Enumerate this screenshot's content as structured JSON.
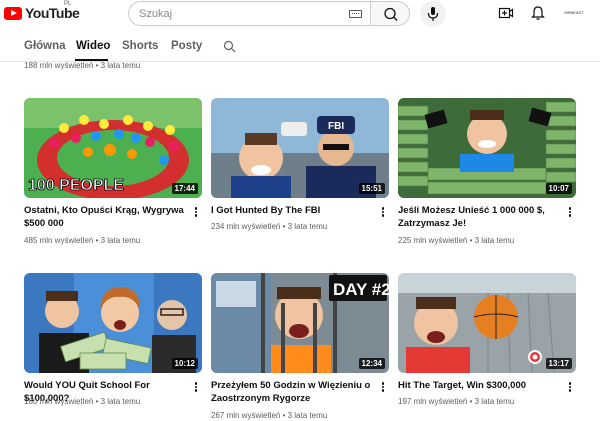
{
  "header": {
    "logo_text": "YouTube",
    "region": "PL",
    "search_placeholder": "Szukaj",
    "avatar_label": "MRBEAST"
  },
  "tabs": [
    {
      "label": "Główna",
      "active": false
    },
    {
      "label": "Wideo",
      "active": true
    },
    {
      "label": "Shorts",
      "active": false
    },
    {
      "label": "Posty",
      "active": false
    }
  ],
  "previous_row_meta": "188 mln wyświetleń • 3 lata temu",
  "videos": [
    {
      "title": "Ostatni, Kto Opuści Krąg, Wygrywa $500 000",
      "meta": "485 mln wyświetleń • 3 lata temu",
      "duration": "17:44",
      "thumb_text": "100 PEOPLE"
    },
    {
      "title": "I Got Hunted By The FBI",
      "meta": "234 mln wyświetleń • 3 lata temu",
      "duration": "15:51",
      "thumb_text": "FBI"
    },
    {
      "title": "Jeśli Możesz Unieść 1 000 000 $, Zatrzymasz Je!",
      "meta": "225 mln wyświetleń • 3 lata temu",
      "duration": "10:07",
      "thumb_text": ""
    },
    {
      "title": "Would YOU Quit School For $100,000?",
      "meta": "180 mln wyświetleń • 3 lata temu",
      "duration": "10:12",
      "thumb_text": ""
    },
    {
      "title": "Przeżyłem 50 Godzin w Więzieniu o Zaostrzonym Rygorze",
      "meta": "267 mln wyświetleń • 3 lata temu",
      "duration": "12:34",
      "thumb_text": "DAY #2"
    },
    {
      "title": "Hit The Target, Win $300,000",
      "meta": "197 mln wyświetleń • 3 lata temu",
      "duration": "13:17",
      "thumb_text": ""
    }
  ],
  "colors": {
    "brand": "#ff0000",
    "text": "#0f0f0f",
    "secondary": "#606060"
  }
}
